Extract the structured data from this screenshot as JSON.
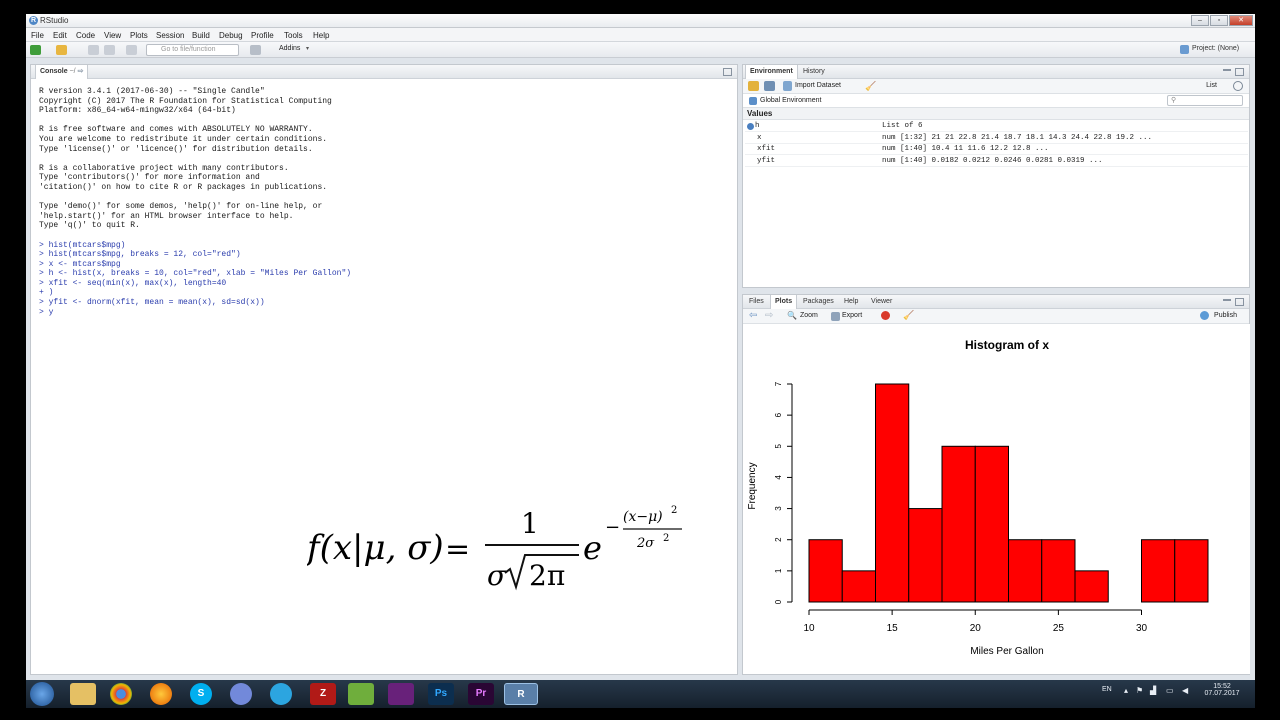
{
  "window": {
    "title": "RStudio",
    "min_glyph": "–",
    "max_glyph": "▫",
    "close_glyph": "✕"
  },
  "menu": [
    "File",
    "Edit",
    "Code",
    "View",
    "Plots",
    "Session",
    "Build",
    "Debug",
    "Profile",
    "Tools",
    "Help"
  ],
  "toolbar": {
    "goto_placeholder": "Go to file/function",
    "addins_label": "Addins",
    "project_label": "Project: (None)"
  },
  "console": {
    "tab_label": "Console",
    "path": "~/",
    "lines": [
      {
        "t": "R version 3.4.1 (2017-06-30) -- \"Single Candle\"",
        "k": "out"
      },
      {
        "t": "Copyright (C) 2017 The R Foundation for Statistical Computing",
        "k": "out"
      },
      {
        "t": "Platform: x86_64-w64-mingw32/x64 (64-bit)",
        "k": "out"
      },
      {
        "t": "",
        "k": "out"
      },
      {
        "t": "R is free software and comes with ABSOLUTELY NO WARRANTY.",
        "k": "out"
      },
      {
        "t": "You are welcome to redistribute it under certain conditions.",
        "k": "out"
      },
      {
        "t": "Type 'license()' or 'licence()' for distribution details.",
        "k": "out"
      },
      {
        "t": "",
        "k": "out"
      },
      {
        "t": "R is a collaborative project with many contributors.",
        "k": "out"
      },
      {
        "t": "Type 'contributors()' for more information and",
        "k": "out"
      },
      {
        "t": "'citation()' on how to cite R or R packages in publications.",
        "k": "out"
      },
      {
        "t": "",
        "k": "out"
      },
      {
        "t": "Type 'demo()' for some demos, 'help()' for on-line help, or",
        "k": "out"
      },
      {
        "t": "'help.start()' for an HTML browser interface to help.",
        "k": "out"
      },
      {
        "t": "Type 'q()' to quit R.",
        "k": "out"
      },
      {
        "t": "",
        "k": "out"
      },
      {
        "t": "> hist(mtcars$mpg)",
        "k": "in"
      },
      {
        "t": "> hist(mtcars$mpg, breaks = 12, col=\"red\")",
        "k": "in"
      },
      {
        "t": "> x <- mtcars$mpg",
        "k": "in"
      },
      {
        "t": "> h <- hist(x, breaks = 10, col=\"red\", xlab = \"Miles Per Gallon\")",
        "k": "in"
      },
      {
        "t": "> xfit <- seq(min(x), max(x), length=40",
        "k": "in"
      },
      {
        "t": "+ )",
        "k": "in"
      },
      {
        "t": "> yfit <- dnorm(xfit, mean = mean(x), sd=sd(x))",
        "k": "in"
      },
      {
        "t": "> y",
        "k": "in"
      }
    ]
  },
  "environment": {
    "tabs": [
      "Environment",
      "History"
    ],
    "import_label": "Import Dataset",
    "view_mode": "List",
    "scope": "Global Environment",
    "section": "Values",
    "rows": [
      {
        "name": "h",
        "value": "List of 6"
      },
      {
        "name": "x",
        "value": "num [1:32] 21 21 22.8 21.4 18.7 18.1 14.3 24.4 22.8 19.2 ..."
      },
      {
        "name": "xfit",
        "value": "num [1:40] 10.4 11 11.6 12.2 12.8 ..."
      },
      {
        "name": "yfit",
        "value": "num [1:40] 0.0182 0.0212 0.0246 0.0281 0.0319 ..."
      }
    ]
  },
  "files_pane": {
    "tabs": [
      "Files",
      "Plots",
      "Packages",
      "Help",
      "Viewer"
    ],
    "zoom_label": "Zoom",
    "export_label": "Export",
    "publish_label": "Publish"
  },
  "formula": {
    "lhs": "f(x|μ, σ)",
    "equals": "=",
    "numerator": "1",
    "sigma": "σ",
    "radicand": "2π",
    "base": "e",
    "minus": "−",
    "exp_numerator": "(x−μ)",
    "exp_num_power": "2",
    "exp_denominator": "2σ",
    "exp_den_power": "2"
  },
  "chart_data": {
    "type": "bar",
    "title": "Histogram of x",
    "xlabel": "Miles Per Gallon",
    "ylabel": "Frequency",
    "bins": [
      [
        10,
        12
      ],
      [
        12,
        14
      ],
      [
        14,
        16
      ],
      [
        16,
        18
      ],
      [
        18,
        20
      ],
      [
        20,
        22
      ],
      [
        22,
        24
      ],
      [
        24,
        26
      ],
      [
        26,
        28
      ],
      [
        28,
        30
      ],
      [
        30,
        32
      ],
      [
        32,
        34
      ]
    ],
    "values": [
      2,
      1,
      7,
      3,
      5,
      5,
      2,
      2,
      1,
      0,
      2,
      2
    ],
    "xticks": [
      10,
      15,
      20,
      25,
      30
    ],
    "yticks": [
      0,
      1,
      2,
      3,
      4,
      5,
      6,
      7
    ],
    "xlim": [
      10,
      34
    ],
    "ylim": [
      0,
      7
    ],
    "bar_color": "#ff0000",
    "grid": false
  },
  "taskbar": {
    "lang": "EN",
    "time": "15:52",
    "date": "07.07.2017"
  }
}
